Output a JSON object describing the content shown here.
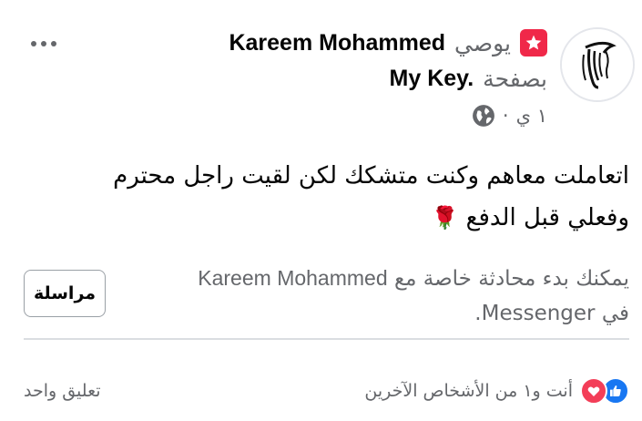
{
  "post": {
    "author": "Kareem Mohammed",
    "recommends_word": "يوصي",
    "on_page_word": "بصفحة",
    "page_name": "My Key.",
    "timestamp": "١ ي",
    "separator": "·",
    "body_line1": "اتعاملت معاهم وكنت متشكك لكن لقيت راجل محترم",
    "body_line2": "وفعلي قبل الدفع",
    "body_emoji": "🌹"
  },
  "messenger": {
    "line1_prefix": "يمكنك بدء محادثة خاصة مع",
    "line1_name": "Kareem Mohammed",
    "line2": "في Messenger.",
    "button_label": "مراسلة"
  },
  "footer": {
    "reactions_text": "أنت و١ من الأشخاص الآخرين",
    "comments_text": "تعليق واحد"
  },
  "icons": {
    "more": "more-options-icon",
    "recommend": "recommend-star-icon",
    "globe": "globe-icon",
    "like": "like-reaction-icon",
    "love": "love-reaction-icon"
  },
  "colors": {
    "recommend": "#f02849",
    "like": "#1877f2",
    "love": "#f33e58",
    "secondary_text": "#65676b"
  }
}
